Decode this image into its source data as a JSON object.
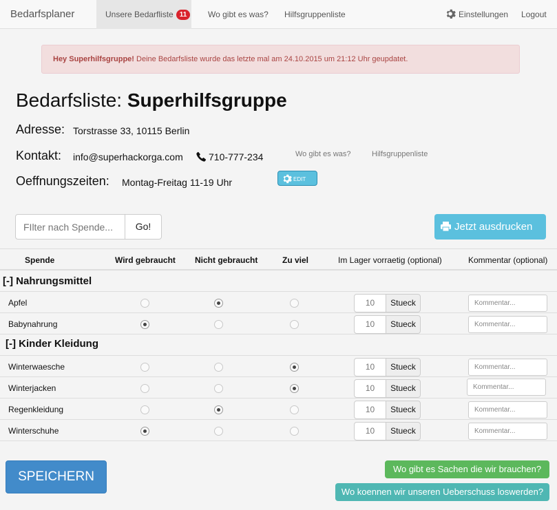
{
  "nav": {
    "brand": "Bedarfsplaner",
    "items": [
      {
        "label": "Unsere Bedarfliste",
        "badge": "11"
      },
      {
        "label": "Wo gibt es was?"
      },
      {
        "label": "Hilfsgruppenliste"
      }
    ],
    "settings": "Einstellungen",
    "logout": "Logout"
  },
  "alert": {
    "strong": "Hey Superhilfsgruppe!",
    "text": " Deine Bedarfsliste wurde das letzte mal am 24.10.2015 um 21:12 Uhr geupdatet."
  },
  "header": {
    "title_prefix": "Bedarfsliste: ",
    "title_name": "Superhilfsgruppe",
    "address_label": "Adresse:",
    "address": "Torstrasse 33, 10115 Berlin",
    "contact_label": "Kontakt:",
    "email": "info@superhackorga.com",
    "phone": "710-777-234",
    "link1": "Wo gibt es was?",
    "link2": "Hilfsgruppenliste",
    "hours_label": "Oeffnungszeiten:",
    "hours": "Montag-Freitag 11-19 Uhr",
    "edit": "EDIT"
  },
  "search": {
    "placeholder": "FIlter nach Spende...",
    "button": "Go!"
  },
  "print_button": "Jetzt ausdrucken",
  "table": {
    "columns": [
      "Spende",
      "Wird gebraucht",
      "Nicht gebraucht",
      "Zu viel",
      "Im Lager vorraetig (optional)",
      "Kommentar (optional)"
    ],
    "sections": [
      {
        "title": "[-] Nahrungsmittel",
        "rows": [
          {
            "name": "Apfel",
            "selected": "nicht",
            "qty": "10",
            "unit": "Stueck",
            "comment_placeholder": "Kommentar..."
          },
          {
            "name": "Babynahrung",
            "selected": "wird",
            "qty": "10",
            "unit": "Stueck",
            "comment_placeholder": "Kommentar..."
          }
        ]
      },
      {
        "title": "[-] Kinder Kleidung",
        "rows": [
          {
            "name": "Winterwaesche",
            "selected": "zuviel",
            "qty": "10",
            "unit": "Stueck",
            "comment_placeholder": "Kommentar..."
          },
          {
            "name": "Winterjacken",
            "selected": "zuviel",
            "qty": "10",
            "unit": "Stueck",
            "comment_placeholder": "Kommentar..."
          },
          {
            "name": "Regenkleidung",
            "selected": "nicht",
            "qty": "10",
            "unit": "Stueck",
            "comment_placeholder": "Kommentar..."
          },
          {
            "name": "Winterschuhe",
            "selected": "wird",
            "qty": "10",
            "unit": "Stueck",
            "comment_placeholder": "Kommentar..."
          }
        ]
      }
    ]
  },
  "buttons": {
    "save": "SPEICHERN",
    "need": "Wo gibt es Sachen die wir brauchen?",
    "surplus": "Wo koennen wir unseren Ueberschuss loswerden?"
  },
  "colors": {
    "info": "#5bc0de",
    "primary": "#428bca",
    "success": "#5cb85c",
    "danger_badge": "#d9232d"
  }
}
